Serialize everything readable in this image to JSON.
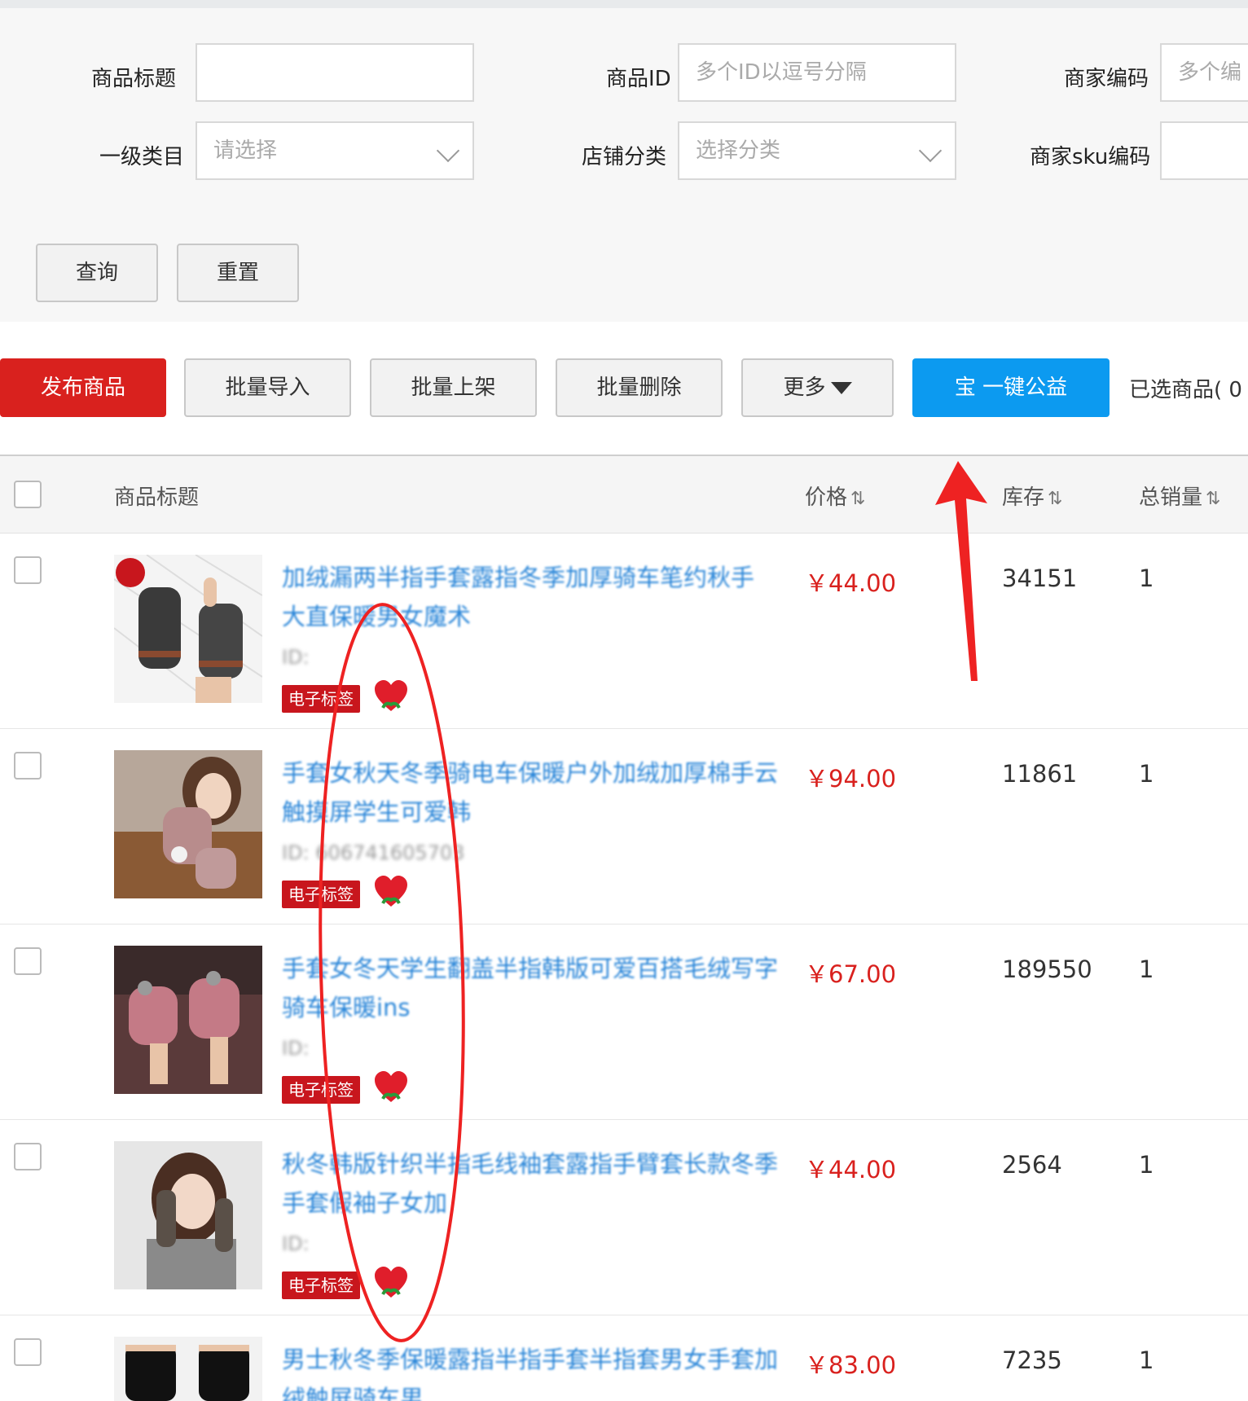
{
  "filters": {
    "title_label": "商品标题",
    "title_value": "",
    "id_label": "商品ID",
    "id_placeholder": "多个ID以逗号分隔",
    "merchant_code_label": "商家编码",
    "merchant_code_placeholder": "多个编",
    "category_label": "一级类目",
    "category_placeholder": "请选择",
    "shop_category_label": "店铺分类",
    "shop_category_placeholder": "选择分类",
    "sku_label": "商家sku编码",
    "query_button": "查询",
    "reset_button": "重置"
  },
  "toolbar": {
    "publish": "发布商品",
    "batch_import": "批量导入",
    "batch_list": "批量上架",
    "batch_delete": "批量删除",
    "more": "更多",
    "charity": "宝 一键公益",
    "selected": "已选商品( 0"
  },
  "table": {
    "headers": {
      "title": "商品标题",
      "price": "价格",
      "stock": "库存",
      "sales": "总销量"
    },
    "sort_icon": "⇅",
    "rows": [
      {
        "title": "加绒漏两半指手套露指冬季加厚骑车笔约秋手 大直保暖男女魔术",
        "id": "ID:",
        "tag": "电子标签",
        "price": "￥44.00",
        "stock": "34151",
        "sales": "1"
      },
      {
        "title": "手套女秋天冬季骑电车保暖户外加绒加厚棉手云触摸屏学生可爱韩",
        "id": "ID: 606741605703",
        "tag": "电子标签",
        "price": "￥94.00",
        "stock": "11861",
        "sales": "1"
      },
      {
        "title": "手套女冬天学生翻盖半指韩版可爱百搭毛绒写字骑车保暖ins",
        "id": "ID:",
        "tag": "电子标签",
        "price": "￥67.00",
        "stock": "189550",
        "sales": "1"
      },
      {
        "title": "秋冬韩版针织半指毛线袖套露指手臂套长款冬季手套假袖子女加",
        "id": "ID:",
        "tag": "电子标签",
        "price": "￥44.00",
        "stock": "2564",
        "sales": "1"
      },
      {
        "title": "男士秋冬季保暖露指半指手套半指套男女手套加绒触屏骑车男",
        "id": "",
        "tag": "",
        "price": "￥83.00",
        "stock": "7235",
        "sales": "1"
      }
    ]
  },
  "colors": {
    "primary_red": "#d9211e",
    "primary_blue": "#0c9af0",
    "link_blue": "#1e7fd6",
    "annotation_red": "#ee2222"
  }
}
